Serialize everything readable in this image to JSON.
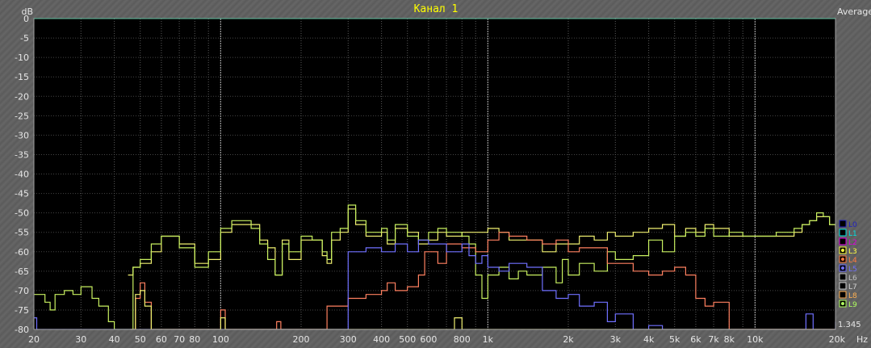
{
  "chart_data": {
    "type": "line",
    "title": "Канал 1",
    "mode_label": "Average",
    "ylabel": "dB",
    "xlabel": "Hz",
    "xscale": "log",
    "xlim": [
      20,
      20000
    ],
    "ylim": [
      -80,
      0
    ],
    "grid": true,
    "y_ticks": [
      0,
      -5,
      -10,
      -15,
      -20,
      -25,
      -30,
      -35,
      -40,
      -45,
      -50,
      -55,
      -60,
      -65,
      -70,
      -75,
      -80
    ],
    "x_ticks": [
      {
        "v": 20,
        "label": "20"
      },
      {
        "v": 30,
        "label": "30"
      },
      {
        "v": 40,
        "label": "40"
      },
      {
        "v": 50,
        "label": "50"
      },
      {
        "v": 60,
        "label": "60"
      },
      {
        "v": 70,
        "label": "70"
      },
      {
        "v": 80,
        "label": "80"
      },
      {
        "v": 100,
        "label": "100"
      },
      {
        "v": 200,
        "label": "200"
      },
      {
        "v": 300,
        "label": "300"
      },
      {
        "v": 400,
        "label": "400"
      },
      {
        "v": 500,
        "label": "500"
      },
      {
        "v": 600,
        "label": "600"
      },
      {
        "v": 800,
        "label": "800"
      },
      {
        "v": 1000,
        "label": "1k"
      },
      {
        "v": 2000,
        "label": "2k"
      },
      {
        "v": 3000,
        "label": "3k"
      },
      {
        "v": 4000,
        "label": "4k"
      },
      {
        "v": 5000,
        "label": "5k"
      },
      {
        "v": 6000,
        "label": "6k"
      },
      {
        "v": 7000,
        "label": "7k"
      },
      {
        "v": 8000,
        "label": "8k"
      },
      {
        "v": 10000,
        "label": "10k"
      },
      {
        "v": 20000,
        "label": "20k"
      }
    ],
    "readout": "1.345",
    "legend_position": "right",
    "legend": [
      {
        "label": "L0",
        "color": "#2020c0",
        "shown": false
      },
      {
        "label": "L1",
        "color": "#00e0e0",
        "shown": false
      },
      {
        "label": "L2",
        "color": "#e000e0",
        "shown": false
      },
      {
        "label": "L3",
        "color": "#ffff40",
        "shown": true
      },
      {
        "label": "L4",
        "color": "#ff7a40",
        "shown": true
      },
      {
        "label": "L5",
        "color": "#7070ff",
        "shown": true
      },
      {
        "label": "L6",
        "color": "#c0c0c0",
        "shown": false
      },
      {
        "label": "L7",
        "color": "#d0d0d0",
        "shown": false
      },
      {
        "label": "L8",
        "color": "#ffb050",
        "shown": false
      },
      {
        "label": "L9",
        "color": "#b0ff60",
        "shown": true
      }
    ],
    "series": [
      {
        "name": "L3",
        "color": "#f0f070",
        "points": [
          [
            45,
            -66
          ],
          [
            47,
            -64
          ],
          [
            50,
            -63
          ],
          [
            55,
            -60
          ],
          [
            60,
            -56
          ],
          [
            70,
            -58
          ],
          [
            80,
            -63
          ],
          [
            90,
            -62
          ],
          [
            100,
            -55
          ],
          [
            110,
            -53
          ],
          [
            130,
            -53
          ],
          [
            140,
            -57
          ],
          [
            150,
            -59
          ],
          [
            160,
            -66
          ],
          [
            170,
            -57
          ],
          [
            180,
            -62
          ],
          [
            200,
            -57
          ],
          [
            220,
            -57
          ],
          [
            240,
            -61
          ],
          [
            250,
            -63
          ],
          [
            260,
            -57
          ],
          [
            280,
            -55
          ],
          [
            300,
            -49
          ],
          [
            320,
            -53
          ],
          [
            350,
            -56
          ],
          [
            400,
            -55
          ],
          [
            420,
            -58
          ],
          [
            450,
            -54
          ],
          [
            500,
            -55
          ],
          [
            550,
            -58
          ],
          [
            600,
            -57
          ],
          [
            650,
            -55
          ],
          [
            700,
            -56
          ],
          [
            800,
            -55
          ],
          [
            900,
            -55
          ],
          [
            1000,
            -54
          ],
          [
            1100,
            -55
          ],
          [
            1200,
            -57
          ],
          [
            1400,
            -57
          ],
          [
            1600,
            -60
          ],
          [
            1800,
            -58
          ],
          [
            2000,
            -58
          ],
          [
            2200,
            -56
          ],
          [
            2500,
            -57
          ],
          [
            2800,
            -55
          ],
          [
            3000,
            -56
          ],
          [
            3500,
            -55
          ],
          [
            4000,
            -54
          ],
          [
            4500,
            -53
          ],
          [
            5000,
            -56
          ],
          [
            5500,
            -54
          ],
          [
            6000,
            -55
          ],
          [
            6500,
            -53
          ],
          [
            7000,
            -54
          ],
          [
            8000,
            -56
          ],
          [
            9000,
            -56
          ],
          [
            10000,
            -56
          ],
          [
            12000,
            -56
          ],
          [
            14000,
            -55
          ],
          [
            15000,
            -53
          ],
          [
            16000,
            -52
          ],
          [
            17000,
            -51
          ],
          [
            18000,
            -51
          ],
          [
            19000,
            -53
          ],
          [
            20000,
            -55
          ]
        ]
      },
      {
        "name": "L9",
        "color": "#c8f060",
        "points": [
          [
            20,
            -71
          ],
          [
            22,
            -73
          ],
          [
            23,
            -75
          ],
          [
            24,
            -71
          ],
          [
            26,
            -70
          ],
          [
            28,
            -71
          ],
          [
            30,
            -69
          ],
          [
            33,
            -72
          ],
          [
            35,
            -74
          ],
          [
            38,
            -78
          ],
          [
            40,
            -80
          ],
          [
            45,
            -80
          ],
          [
            47,
            -64
          ],
          [
            50,
            -62
          ],
          [
            55,
            -58
          ],
          [
            60,
            -56
          ],
          [
            70,
            -59
          ],
          [
            80,
            -64
          ],
          [
            90,
            -60
          ],
          [
            100,
            -54
          ],
          [
            110,
            -52
          ],
          [
            130,
            -54
          ],
          [
            140,
            -58
          ],
          [
            150,
            -62
          ],
          [
            160,
            -66
          ],
          [
            170,
            -58
          ],
          [
            180,
            -60
          ],
          [
            200,
            -56
          ],
          [
            220,
            -57
          ],
          [
            240,
            -60
          ],
          [
            250,
            -62
          ],
          [
            260,
            -55
          ],
          [
            280,
            -54
          ],
          [
            300,
            -48
          ],
          [
            320,
            -52
          ],
          [
            350,
            -55
          ],
          [
            400,
            -54
          ],
          [
            420,
            -57
          ],
          [
            450,
            -53
          ],
          [
            500,
            -56
          ],
          [
            550,
            -57
          ],
          [
            600,
            -55
          ],
          [
            650,
            -54
          ],
          [
            700,
            -55
          ],
          [
            800,
            -56
          ],
          [
            850,
            -58
          ],
          [
            900,
            -66
          ],
          [
            950,
            -72
          ],
          [
            1000,
            -66
          ],
          [
            1100,
            -64
          ],
          [
            1200,
            -67
          ],
          [
            1300,
            -65
          ],
          [
            1400,
            -66
          ],
          [
            1600,
            -64
          ],
          [
            1800,
            -68
          ],
          [
            1900,
            -62
          ],
          [
            2000,
            -66
          ],
          [
            2200,
            -63
          ],
          [
            2500,
            -65
          ],
          [
            2800,
            -60
          ],
          [
            3000,
            -62
          ],
          [
            3500,
            -61
          ],
          [
            4000,
            -57
          ],
          [
            4500,
            -60
          ],
          [
            5000,
            -56
          ],
          [
            5500,
            -55
          ],
          [
            6000,
            -56
          ],
          [
            6500,
            -54
          ],
          [
            7000,
            -56
          ],
          [
            8000,
            -55
          ],
          [
            9000,
            -56
          ],
          [
            10000,
            -56
          ],
          [
            12000,
            -55
          ],
          [
            14000,
            -54
          ],
          [
            15000,
            -53
          ],
          [
            16000,
            -52
          ],
          [
            17000,
            -50
          ],
          [
            18000,
            -51
          ],
          [
            19000,
            -53
          ],
          [
            20000,
            -54
          ]
        ]
      },
      {
        "name": "L4",
        "color": "#ff8060",
        "points": [
          [
            46,
            -80
          ],
          [
            48,
            -72
          ],
          [
            50,
            -68
          ],
          [
            52,
            -73
          ],
          [
            55,
            -80
          ],
          [
            99,
            -80
          ],
          [
            100,
            -75
          ],
          [
            104,
            -80
          ],
          [
            160,
            -80
          ],
          [
            162,
            -78
          ],
          [
            168,
            -80
          ],
          [
            240,
            -80
          ],
          [
            250,
            -74
          ],
          [
            300,
            -72
          ],
          [
            350,
            -71
          ],
          [
            400,
            -70
          ],
          [
            420,
            -68
          ],
          [
            450,
            -70
          ],
          [
            500,
            -69
          ],
          [
            550,
            -66
          ],
          [
            580,
            -60
          ],
          [
            600,
            -60
          ],
          [
            650,
            -63
          ],
          [
            700,
            -58
          ],
          [
            800,
            -59
          ],
          [
            900,
            -60
          ],
          [
            1000,
            -57
          ],
          [
            1100,
            -55
          ],
          [
            1200,
            -56
          ],
          [
            1400,
            -57
          ],
          [
            1600,
            -58
          ],
          [
            1800,
            -57
          ],
          [
            2000,
            -60
          ],
          [
            2200,
            -59
          ],
          [
            2500,
            -59
          ],
          [
            2800,
            -63
          ],
          [
            3000,
            -63
          ],
          [
            3500,
            -65
          ],
          [
            4000,
            -66
          ],
          [
            4500,
            -65
          ],
          [
            5000,
            -64
          ],
          [
            5500,
            -66
          ],
          [
            6000,
            -72
          ],
          [
            6500,
            -74
          ],
          [
            7000,
            -73
          ],
          [
            8000,
            -80
          ],
          [
            20000,
            -80
          ]
        ]
      },
      {
        "name": "L5",
        "color": "#7070ff",
        "points": [
          [
            20,
            -77
          ],
          [
            20.5,
            -80
          ],
          [
            250,
            -80
          ],
          [
            300,
            -60
          ],
          [
            350,
            -59
          ],
          [
            400,
            -60
          ],
          [
            450,
            -58
          ],
          [
            500,
            -60
          ],
          [
            550,
            -57
          ],
          [
            600,
            -58
          ],
          [
            650,
            -58
          ],
          [
            700,
            -60
          ],
          [
            800,
            -58
          ],
          [
            850,
            -61
          ],
          [
            900,
            -63
          ],
          [
            950,
            -61
          ],
          [
            1000,
            -64
          ],
          [
            1100,
            -65
          ],
          [
            1200,
            -63
          ],
          [
            1400,
            -64
          ],
          [
            1600,
            -70
          ],
          [
            1800,
            -72
          ],
          [
            2000,
            -71
          ],
          [
            2200,
            -74
          ],
          [
            2500,
            -73
          ],
          [
            2800,
            -78
          ],
          [
            3000,
            -76
          ],
          [
            3500,
            -80
          ],
          [
            4000,
            -79
          ],
          [
            4500,
            -80
          ],
          [
            15000,
            -80
          ],
          [
            15500,
            -76
          ],
          [
            16500,
            -80
          ],
          [
            19000,
            -80
          ],
          [
            20000,
            -78
          ]
        ]
      },
      {
        "name": "L8",
        "color": "#f0f070",
        "points": [
          [
            46,
            -80
          ],
          [
            48,
            -71
          ],
          [
            50,
            -70
          ],
          [
            52,
            -74
          ],
          [
            55,
            -80
          ],
          [
            99,
            -80
          ],
          [
            100,
            -77
          ],
          [
            104,
            -80
          ],
          [
            720,
            -80
          ],
          [
            750,
            -77
          ],
          [
            800,
            -80
          ],
          [
            20000,
            -80
          ]
        ]
      }
    ]
  }
}
